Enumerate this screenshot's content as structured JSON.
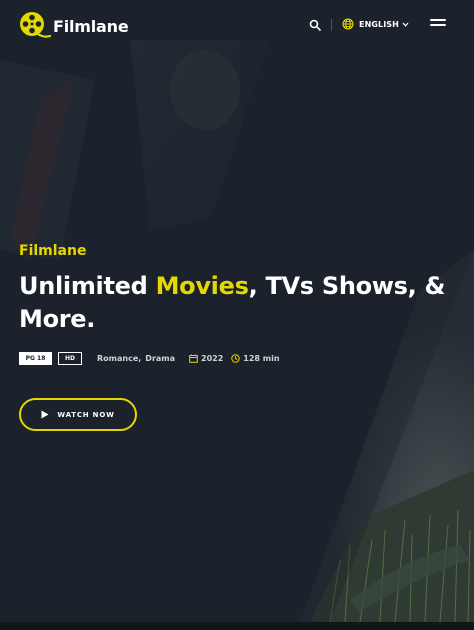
{
  "brand": {
    "name": "Filmlane",
    "accent_color": "#e4d804",
    "logo_icon": "film-reel-icon"
  },
  "header": {
    "search_icon": "search-icon",
    "language": {
      "label": "ENGLISH",
      "icon": "globe-icon",
      "chevron": "chevron-down-icon"
    },
    "menu_icon": "hamburger-menu-icon"
  },
  "hero": {
    "subtitle": "Filmlane",
    "title_part1": "Unlimited ",
    "title_accent": "Movies",
    "title_part2": ", TVs Shows, & More.",
    "badges": {
      "rating": "PG 18",
      "quality": "HD"
    },
    "genres": [
      "Romance,",
      "Drama"
    ],
    "year": "2022",
    "duration": "128 min",
    "watch_button": "WATCH NOW"
  }
}
